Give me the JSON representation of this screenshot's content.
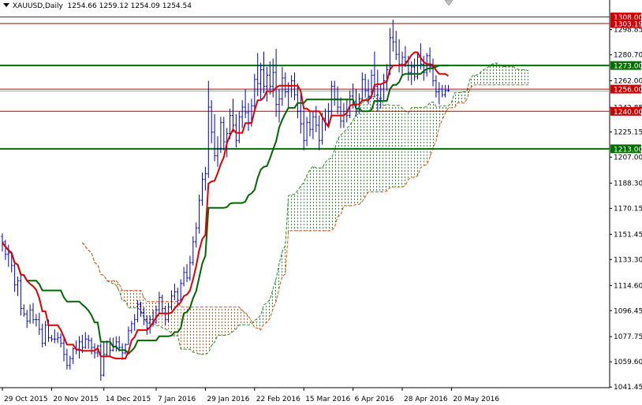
{
  "header": {
    "symbol": "XAUUSD,Daily",
    "ohlc": "1254.66 1259.12 1254.09 1254.54"
  },
  "colors": {
    "candle": "#0000cc",
    "tenkan": "#e00000",
    "kijun": "#006600",
    "kumo_bull": "#2e8b2e",
    "kumo_bear": "#e05010",
    "level_red": "#c00000",
    "level_green": "#007000",
    "grid": "#000000",
    "label_red_bg": "#cc0000",
    "label_green_bg": "#007000"
  },
  "chart_data": {
    "type": "candlestick",
    "symbol": "XAUUSD",
    "timeframe": "Daily",
    "ylim": [
      1041.0,
      1314.5
    ],
    "y_ticks": [
      "1298.85",
      "1280.70",
      "1262.00",
      "1242.85",
      "1225.15",
      "1207.00",
      "1188.30",
      "1170.15",
      "1151.45",
      "1133.30",
      "1114.60",
      "1096.45",
      "1077.75",
      "1059.60",
      "1041.45"
    ],
    "x_ticks": [
      "29 Oct 2015",
      "20 Nov 2015",
      "14 Dec 2015",
      "7 Jan 2016",
      "29 Jan 2016",
      "22 Feb 2016",
      "15 Mar 2016",
      "6 Apr 2016",
      "28 Apr 2016",
      "20 May 2016"
    ],
    "x_tick_bars": [
      0,
      16,
      33,
      50,
      66,
      82,
      98,
      114,
      130,
      146
    ],
    "levels": [
      {
        "label": "1308.00",
        "value": 1308.0,
        "kind": "red"
      },
      {
        "label": "1303.19",
        "value": 1303.19,
        "kind": "red"
      },
      {
        "label": "1273.00",
        "value": 1273.0,
        "kind": "green"
      },
      {
        "label": "1256.00",
        "value": 1256.0,
        "kind": "red"
      },
      {
        "label": "1240.00",
        "value": 1240.0,
        "kind": "red"
      },
      {
        "label": "1213.00",
        "value": 1213.0,
        "kind": "green"
      }
    ],
    "current_price": 1254.54,
    "bars_visible": 146,
    "kumo_shift": 26,
    "ohlc": [
      [
        1150.0,
        1152.0,
        1139.0,
        1146.0
      ],
      [
        1146.0,
        1147.5,
        1133.0,
        1137.0
      ],
      [
        1137.0,
        1144.0,
        1128.0,
        1138.0
      ],
      [
        1138.0,
        1139.0,
        1124.0,
        1129.0
      ],
      [
        1129.0,
        1132.0,
        1110.0,
        1115.0
      ],
      [
        1115.0,
        1121.0,
        1107.0,
        1118.0
      ],
      [
        1118.0,
        1122.0,
        1093.0,
        1098.0
      ],
      [
        1098.0,
        1101.0,
        1092.0,
        1094.0
      ],
      [
        1094.0,
        1097.0,
        1084.0,
        1089.0
      ],
      [
        1089.0,
        1101.0,
        1087.0,
        1097.0
      ],
      [
        1097.0,
        1102.0,
        1087.0,
        1090.0
      ],
      [
        1090.0,
        1094.0,
        1085.0,
        1090.0
      ],
      [
        1090.0,
        1095.0,
        1079.0,
        1083.0
      ],
      [
        1083.0,
        1087.0,
        1070.0,
        1073.0
      ],
      [
        1073.0,
        1089.0,
        1071.0,
        1086.0
      ],
      [
        1086.0,
        1090.0,
        1074.0,
        1077.0
      ],
      [
        1077.0,
        1079.0,
        1074.0,
        1076.0
      ],
      [
        1076.0,
        1083.0,
        1073.0,
        1076.0
      ],
      [
        1076.0,
        1081.0,
        1073.0,
        1077.0
      ],
      [
        1077.0,
        1080.0,
        1070.0,
        1073.0
      ],
      [
        1073.0,
        1077.0,
        1060.0,
        1065.0
      ],
      [
        1065.0,
        1069.0,
        1054.0,
        1057.0
      ],
      [
        1057.0,
        1064.0,
        1054.0,
        1062.0
      ],
      [
        1062.0,
        1070.0,
        1058.0,
        1069.0
      ],
      [
        1069.0,
        1075.0,
        1065.0,
        1068.0
      ],
      [
        1068.0,
        1078.0,
        1062.0,
        1074.0
      ],
      [
        1074.0,
        1079.0,
        1066.0,
        1070.0
      ],
      [
        1070.0,
        1081.0,
        1069.0,
        1076.0
      ],
      [
        1076.0,
        1079.0,
        1069.0,
        1075.0
      ],
      [
        1075.0,
        1077.0,
        1065.0,
        1070.0
      ],
      [
        1070.0,
        1073.0,
        1062.0,
        1066.0
      ],
      [
        1066.0,
        1072.0,
        1063.0,
        1071.0
      ],
      [
        1071.0,
        1073.0,
        1046.0,
        1050.0
      ],
      [
        1050.0,
        1074.0,
        1049.0,
        1065.0
      ],
      [
        1065.0,
        1075.0,
        1063.0,
        1074.0
      ],
      [
        1074.0,
        1077.0,
        1064.0,
        1068.0
      ],
      [
        1068.0,
        1077.0,
        1067.0,
        1071.0
      ],
      [
        1071.0,
        1078.0,
        1067.0,
        1074.0
      ],
      [
        1074.0,
        1078.0,
        1067.0,
        1070.0
      ],
      [
        1070.0,
        1073.0,
        1061.0,
        1066.0
      ],
      [
        1066.0,
        1073.0,
        1065.0,
        1072.0
      ],
      [
        1072.0,
        1085.0,
        1072.0,
        1082.0
      ],
      [
        1082.0,
        1089.0,
        1080.0,
        1087.0
      ],
      [
        1087.0,
        1094.0,
        1082.0,
        1090.0
      ],
      [
        1090.0,
        1104.0,
        1088.0,
        1101.0
      ],
      [
        1101.0,
        1103.0,
        1092.0,
        1095.0
      ],
      [
        1095.0,
        1099.0,
        1086.0,
        1090.0
      ],
      [
        1090.0,
        1093.0,
        1079.0,
        1084.0
      ],
      [
        1084.0,
        1093.0,
        1080.0,
        1090.0
      ],
      [
        1090.0,
        1097.0,
        1085.0,
        1088.0
      ],
      [
        1088.0,
        1100.0,
        1087.0,
        1097.0
      ],
      [
        1097.0,
        1110.0,
        1094.0,
        1106.0
      ],
      [
        1106.0,
        1108.0,
        1095.0,
        1098.0
      ],
      [
        1098.0,
        1100.0,
        1086.0,
        1090.0
      ],
      [
        1090.0,
        1102.0,
        1088.0,
        1099.0
      ],
      [
        1099.0,
        1111.0,
        1097.0,
        1107.0
      ],
      [
        1107.0,
        1116.0,
        1104.0,
        1110.0
      ],
      [
        1110.0,
        1113.0,
        1100.0,
        1104.0
      ],
      [
        1104.0,
        1119.0,
        1102.0,
        1116.0
      ],
      [
        1116.0,
        1128.0,
        1114.0,
        1124.0
      ],
      [
        1124.0,
        1130.0,
        1117.0,
        1120.0
      ],
      [
        1120.0,
        1136.0,
        1118.0,
        1131.0
      ],
      [
        1131.0,
        1150.0,
        1129.0,
        1146.0
      ],
      [
        1146.0,
        1160.0,
        1142.0,
        1156.0
      ],
      [
        1156.0,
        1180.0,
        1152.0,
        1176.0
      ],
      [
        1176.0,
        1196.0,
        1172.0,
        1191.0
      ],
      [
        1191.0,
        1200.0,
        1183.0,
        1195.0
      ],
      [
        1195.0,
        1262.0,
        1192.0,
        1243.0
      ],
      [
        1243.0,
        1248.0,
        1217.0,
        1225.0
      ],
      [
        1225.0,
        1238.0,
        1204.0,
        1208.0
      ],
      [
        1208.0,
        1222.0,
        1200.0,
        1213.0
      ],
      [
        1213.0,
        1236.0,
        1210.0,
        1232.0
      ],
      [
        1232.0,
        1236.0,
        1212.0,
        1218.0
      ],
      [
        1218.0,
        1228.0,
        1207.0,
        1224.0
      ],
      [
        1224.0,
        1242.0,
        1220.0,
        1237.0
      ],
      [
        1237.0,
        1249.0,
        1225.0,
        1230.0
      ],
      [
        1230.0,
        1238.0,
        1214.0,
        1219.0
      ],
      [
        1219.0,
        1240.0,
        1217.0,
        1236.0
      ],
      [
        1236.0,
        1248.0,
        1228.0,
        1243.0
      ],
      [
        1243.0,
        1256.0,
        1235.0,
        1239.0
      ],
      [
        1239.0,
        1246.0,
        1226.0,
        1232.0
      ],
      [
        1232.0,
        1249.0,
        1229.0,
        1244.0
      ],
      [
        1244.0,
        1267.0,
        1240.0,
        1263.0
      ],
      [
        1263.0,
        1282.0,
        1251.0,
        1260.0
      ],
      [
        1260.0,
        1275.0,
        1248.0,
        1270.0
      ],
      [
        1270.0,
        1283.0,
        1253.0,
        1258.0
      ],
      [
        1258.0,
        1272.0,
        1247.0,
        1266.0
      ],
      [
        1266.0,
        1276.0,
        1252.0,
        1258.0
      ],
      [
        1258.0,
        1278.0,
        1250.0,
        1268.0
      ],
      [
        1268.0,
        1285.0,
        1236.0,
        1245.0
      ],
      [
        1245.0,
        1256.0,
        1232.0,
        1249.0
      ],
      [
        1249.0,
        1272.0,
        1244.0,
        1264.0
      ],
      [
        1264.0,
        1268.0,
        1250.0,
        1254.0
      ],
      [
        1254.0,
        1261.0,
        1242.0,
        1258.0
      ],
      [
        1258.0,
        1266.0,
        1250.0,
        1262.0
      ],
      [
        1262.0,
        1268.0,
        1248.0,
        1252.0
      ],
      [
        1252.0,
        1260.0,
        1235.0,
        1240.0
      ],
      [
        1240.0,
        1252.0,
        1224.0,
        1231.0
      ],
      [
        1231.0,
        1241.0,
        1212.0,
        1219.0
      ],
      [
        1219.0,
        1236.0,
        1215.0,
        1232.0
      ],
      [
        1232.0,
        1240.0,
        1222.0,
        1227.0
      ],
      [
        1227.0,
        1240.0,
        1220.0,
        1236.0
      ],
      [
        1236.0,
        1244.0,
        1225.0,
        1230.0
      ],
      [
        1230.0,
        1237.0,
        1212.0,
        1219.0
      ],
      [
        1219.0,
        1239.0,
        1216.0,
        1235.0
      ],
      [
        1235.0,
        1242.0,
        1226.0,
        1231.0
      ],
      [
        1231.0,
        1246.0,
        1229.0,
        1240.0
      ],
      [
        1240.0,
        1262.0,
        1237.0,
        1258.0
      ],
      [
        1258.0,
        1262.0,
        1244.0,
        1249.0
      ],
      [
        1249.0,
        1258.0,
        1238.0,
        1243.0
      ],
      [
        1243.0,
        1250.0,
        1228.0,
        1233.0
      ],
      [
        1233.0,
        1246.0,
        1228.0,
        1240.0
      ],
      [
        1240.0,
        1249.0,
        1232.0,
        1237.0
      ],
      [
        1237.0,
        1255.0,
        1235.0,
        1251.0
      ],
      [
        1251.0,
        1260.0,
        1242.0,
        1247.0
      ],
      [
        1247.0,
        1256.0,
        1236.0,
        1242.0
      ],
      [
        1242.0,
        1253.0,
        1238.0,
        1249.0
      ],
      [
        1249.0,
        1268.0,
        1247.0,
        1263.0
      ],
      [
        1263.0,
        1267.0,
        1250.0,
        1255.0
      ],
      [
        1255.0,
        1263.0,
        1245.0,
        1251.0
      ],
      [
        1251.0,
        1270.0,
        1249.0,
        1266.0
      ],
      [
        1266.0,
        1283.0,
        1250.0,
        1258.0
      ],
      [
        1258.0,
        1270.0,
        1240.0,
        1248.0
      ],
      [
        1248.0,
        1260.0,
        1242.0,
        1256.0
      ],
      [
        1256.0,
        1267.0,
        1248.0,
        1262.0
      ],
      [
        1262.0,
        1274.0,
        1255.0,
        1270.0
      ],
      [
        1270.0,
        1300.0,
        1266.0,
        1293.0
      ],
      [
        1293.0,
        1306.0,
        1283.0,
        1290.0
      ],
      [
        1290.0,
        1298.0,
        1277.0,
        1281.0
      ],
      [
        1281.0,
        1292.0,
        1268.0,
        1274.0
      ],
      [
        1274.0,
        1283.0,
        1265.0,
        1279.0
      ],
      [
        1279.0,
        1287.0,
        1272.0,
        1276.0
      ],
      [
        1276.0,
        1280.0,
        1262.0,
        1268.0
      ],
      [
        1268.0,
        1276.0,
        1259.0,
        1272.0
      ],
      [
        1272.0,
        1278.0,
        1262.0,
        1265.0
      ],
      [
        1265.0,
        1283.0,
        1263.0,
        1279.0
      ],
      [
        1279.0,
        1289.0,
        1270.0,
        1274.0
      ],
      [
        1274.0,
        1280.0,
        1262.0,
        1268.0
      ],
      [
        1268.0,
        1282.0,
        1265.0,
        1280.0
      ],
      [
        1280.0,
        1286.0,
        1268.0,
        1272.0
      ],
      [
        1272.0,
        1278.0,
        1258.0,
        1262.0
      ],
      [
        1262.0,
        1266.0,
        1250.0,
        1254.0
      ],
      [
        1254.0,
        1261.0,
        1245.0,
        1256.0
      ],
      [
        1256.0,
        1259.0,
        1250.0,
        1252.0
      ],
      [
        1252.0,
        1259.0,
        1250.0,
        1255.0
      ],
      [
        1255.0,
        1259.0,
        1254.0,
        1255.0
      ]
    ]
  }
}
